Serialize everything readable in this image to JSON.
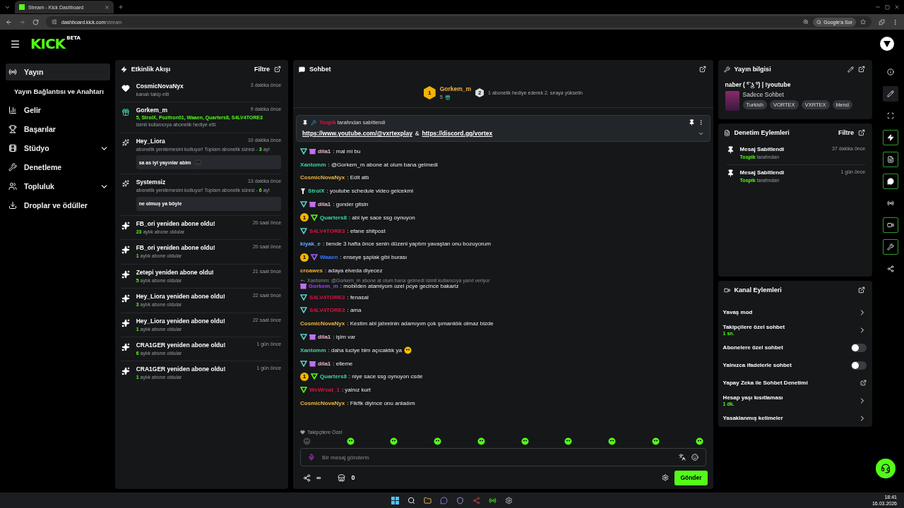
{
  "browser": {
    "tab_title": "Stream - Kick Dashboard",
    "url_host": "dashboard.kick.com",
    "url_path": "/stream",
    "ask_google": "Google'a Sor"
  },
  "header": {
    "logo": "KICK",
    "logo_badge": "BETA"
  },
  "nav": [
    {
      "label": "Yayın",
      "selected": true,
      "children": [
        {
          "label": "Yayın Bağlantısı ve Anahtarı",
          "selected": false
        }
      ]
    },
    {
      "label": "Gelir",
      "selected": false
    },
    {
      "label": "Başarılar",
      "selected": false
    },
    {
      "label": "Stüdyo",
      "selected": false,
      "expandable": true
    },
    {
      "label": "Denetleme",
      "selected": false
    },
    {
      "label": "Topluluk",
      "selected": false,
      "expandable": true
    },
    {
      "label": "Droplar ve ödüller",
      "selected": false
    }
  ],
  "activity": {
    "title": "Etkinlik Akışı",
    "filter": "Filtre",
    "items": [
      {
        "kind": "follow",
        "user": "CosmicNovaNyx",
        "time": "3 dakika önce",
        "text": "kanalı takip etti"
      },
      {
        "kind": "gift",
        "user": "Gorkem_m",
        "time": "9 dakika önce",
        "recipients": "5, StroiX, Pozitron01, Waaen, Quarters8, S4LV4TORE3",
        "text": "isimli kullanıcıya abonelik hediye etti."
      },
      {
        "kind": "renewal",
        "user": "Hey_Liora",
        "time": "10 dakika önce",
        "text": "abonelik yenilemesini kutluyor! Toplam abonelik süresi - ",
        "months": "3",
        "suffix": " ay!",
        "message": "sa as iyi yayınlar abim",
        "emote": true
      },
      {
        "kind": "renewal",
        "user": "Systemsiz",
        "time": "13 dakika önce",
        "text": "abonelik yenilemesini kutluyor! Toplam abonelik süresi - ",
        "months": "6",
        "suffix": " ay!",
        "message": "ne olmuş ya böyle",
        "emote": false
      },
      {
        "kind": "resub",
        "title": "FB_ori yeniden abone oldu!",
        "time": "20 saat önce",
        "months": "23",
        "text": " aylık abone oldular"
      },
      {
        "kind": "resub",
        "title": "FB_ori yeniden abone oldu!",
        "time": "20 saat önce",
        "months": "1",
        "text": " aylık abone oldular"
      },
      {
        "kind": "resub",
        "title": "Zetepi yeniden abone oldu!",
        "time": "21 saat önce",
        "months": "5",
        "text": " aylık abone oldular"
      },
      {
        "kind": "resub",
        "title": "Hey_Liora yeniden abone oldu!",
        "time": "22 saat önce",
        "months": "3",
        "text": " aylık abone oldular"
      },
      {
        "kind": "resub",
        "title": "Hey_Liora yeniden abone oldu!",
        "time": "22 saat önce",
        "months": "1",
        "text": " aylık abone oldular"
      },
      {
        "kind": "resub",
        "title": "CRA1GER yeniden abone oldu!",
        "time": "1 gün önce",
        "months": "6",
        "text": " aylık abone oldular"
      },
      {
        "kind": "resub",
        "title": "CRA1GER yeniden abone oldu!",
        "time": "1 gün önce",
        "months": "1",
        "text": " aylık abone oldular"
      }
    ]
  },
  "chat": {
    "title": "Sohbet",
    "leader": {
      "rank": "1",
      "name": "Gorkem_m",
      "count": "5",
      "next_rank": "2",
      "hint": "1 abonelik hediye ederek 2. sıraya yükselin"
    },
    "pinned": {
      "by": "Tospik",
      "by_text": "tarafından sabitlendi",
      "link_1": "https://www.youtube.com/@vxrtexplay",
      "joiner": "&",
      "link_2": "https://discord.gg/vortex"
    },
    "messages": [
      {
        "badges": [
          {
            "kind": "shield",
            "color": "#5fc8c8"
          },
          {
            "kind": "gift",
            "color": "#c070f0"
          }
        ],
        "user": "dila1",
        "color": "#f0b8d0",
        "text": ": mal mi bu"
      },
      {
        "user": "Xantomm",
        "color": "#3fd6a6",
        "text": ": @Gorkem_m abone at olum bana gelmedi"
      },
      {
        "user": "CosmicNovaNyx",
        "color": "#f2b440",
        "text": ": Edit attı"
      },
      {
        "badges": [
          {
            "kind": "sword",
            "color": "#e8e8e8"
          }
        ],
        "user": "StroiX",
        "color": "#3fd6a6",
        "text": ": youtube schedule video gelcekmi"
      },
      {
        "badges": [
          {
            "kind": "shield",
            "color": "#5fc8c8"
          },
          {
            "kind": "gift",
            "color": "#c070f0"
          }
        ],
        "user": "dila1",
        "color": "#f0b8d0",
        "text": ": gonder gitsin"
      },
      {
        "rank": "1",
        "badges": [
          {
            "kind": "shield",
            "color": "#53fc18"
          }
        ],
        "user": "Quarters8",
        "color": "#3fd6a6",
        "text": ": abi iye sace ssg oynuyon"
      },
      {
        "badges": [
          {
            "kind": "shield",
            "color": "#5fc8c8"
          }
        ],
        "user": "S4LV4TORE3",
        "color": "#e01040",
        "text": ": efane shitpost"
      },
      {
        "user": "kiyak_e",
        "color": "#6ca8ff",
        "text": ": bende 3 hafta önce senin düzeni yaptım yavaştan onu bozuyorum"
      },
      {
        "rank": "1",
        "badges": [
          {
            "kind": "shield",
            "color": "#a060f0"
          }
        ],
        "user": "Waaen",
        "color": "#3a78ff",
        "text": ": enseye şaplak gibi burası"
      },
      {
        "user": "croawes",
        "color": "#f2b440",
        "text": ": adaya elveda diyecez"
      },
      {
        "reply": "Xantomm: @Gorkem_m abone at olum bana gelmedi isimli kullanıcıya yanıt veriyor",
        "badges": [
          {
            "kind": "gift",
            "color": "#c070f0"
          }
        ],
        "user": "Gorkem_m",
        "color": "#a040ff",
        "text": ": mobilden atamiyom ozel pcye gecince bakariz"
      },
      {
        "badges": [
          {
            "kind": "shield",
            "color": "#5fc8c8"
          }
        ],
        "user": "S4LV4TORE3",
        "color": "#e01040",
        "text": ": fenasal"
      },
      {
        "badges": [
          {
            "kind": "shield",
            "color": "#5fc8c8"
          }
        ],
        "user": "S4LV4TORE3",
        "color": "#e01040",
        "text": ": ama"
      },
      {
        "user": "CosmicNovaNyx",
        "color": "#f2b440",
        "text": ": Kestim abi jahreinin adamıyım çok şımarıklık olmaz bizde"
      },
      {
        "badges": [
          {
            "kind": "shield",
            "color": "#5fc8c8"
          },
          {
            "kind": "gift",
            "color": "#c070f0"
          }
        ],
        "user": "dila1",
        "color": "#f0b8d0",
        "text": ": işim var"
      },
      {
        "user": "Xantomm",
        "color": "#3fd6a6",
        "text": ": daha luciye bim açıcaktık ya",
        "emote": true
      },
      {
        "badges": [
          {
            "kind": "shield",
            "color": "#5fc8c8"
          },
          {
            "kind": "gift",
            "color": "#c070f0"
          }
        ],
        "user": "dila1",
        "color": "#f0b8d0",
        "text": ": elleme"
      },
      {
        "rank": "1",
        "badges": [
          {
            "kind": "shield",
            "color": "#53fc18"
          }
        ],
        "user": "Quarters8",
        "color": "#3fd6a6",
        "text": ": niye sace ssg oynuyon csde"
      },
      {
        "badges": [
          {
            "kind": "shield",
            "color": "#53fc18"
          }
        ],
        "user": "WeWreat_1",
        "color": "#e01040",
        "text": ": yalnız kurt"
      },
      {
        "user": "CosmicNovaNyx",
        "color": "#f2b440",
        "text": ": Fikfik diyince onu anladım"
      }
    ],
    "emote_label": "Takipçilere Özel",
    "placeholder": "Bir mesaj gönderin",
    "infinity": "∞",
    "store_count": "0",
    "send": "Gönder"
  },
  "stream_info": {
    "title": "Yayın bilgisi",
    "stream_title": "naber ( ͡° ͜ʖ ͡°) | !youtube",
    "category": "Sadece Sohbet",
    "tags": [
      "Turkish",
      "VORTEX",
      "VXRTEX",
      "blend"
    ]
  },
  "mod_actions": {
    "title": "Denetim Eylemleri",
    "filter": "Filtre",
    "items": [
      {
        "action": "Mesaj Sabitlendi",
        "by": "Tospik",
        "by_text": " tarafından",
        "time": "37 dakika önce"
      },
      {
        "action": "Mesaj Sabitlendi",
        "by": "Tospik",
        "by_text": " tarafından",
        "time": "1 gün önce"
      }
    ]
  },
  "channel_actions": {
    "title": "Kanal Eylemleri",
    "rows": [
      {
        "kind": "link",
        "label": "Yavaş mod"
      },
      {
        "kind": "link",
        "label": "Takipçilere özel sohbet",
        "value": "1 sn."
      },
      {
        "kind": "toggle",
        "label": "Abonelere özel sohbet",
        "on": false
      },
      {
        "kind": "toggle",
        "label": "Yalnızca ifadelerle sohbet",
        "on": false
      },
      {
        "kind": "external",
        "label": "Yapay Zeka ile Sohbet Denetimi"
      },
      {
        "kind": "link",
        "label": "Hesap yaşı kısıtlaması",
        "value": "1 dk."
      },
      {
        "kind": "link",
        "label": "Yasaklanmış kelimeler"
      }
    ]
  },
  "rail": [
    {
      "on": false,
      "selected": false
    },
    {
      "on": false,
      "selected": true
    },
    {
      "on": false,
      "selected": false
    },
    {
      "on": true,
      "selected": false
    },
    {
      "on": true,
      "selected": false
    },
    {
      "on": true,
      "selected": false
    },
    {
      "on": false,
      "selected": false
    },
    {
      "on": true,
      "selected": false
    },
    {
      "on": true,
      "selected": false
    },
    {
      "on": false,
      "selected": false
    }
  ],
  "taskbar": {
    "time": "18:41",
    "date": "16.03.2026"
  }
}
